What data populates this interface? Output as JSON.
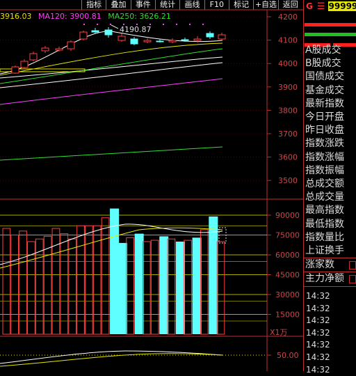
{
  "toolbar": [
    "指标",
    "叠加",
    "事件",
    "统计",
    "画线",
    "F10",
    "标记",
    "+自选",
    "返回"
  ],
  "ma_legend": {
    "ma_prev": "3916.03",
    "ma120": "MA120: 3900.81",
    "ma250": "MA250: 3626.21",
    "colors": {
      "ma_prev": "#e8e800",
      "ma120": "#ff40ff",
      "ma250": "#30e030"
    }
  },
  "price_annotation": "4190.87",
  "volume_unit": "X1万",
  "header": {
    "g": "G",
    "menu": "☰",
    "code": "99999"
  },
  "side_labels": [
    "A股成交",
    "B股成交",
    "国债成交",
    "基金成交",
    "最新指数",
    "今日开盘",
    "昨日收盘",
    "指数涨跌",
    "指数涨幅",
    "指数振幅",
    "总成交额",
    "总成交量",
    "最高指数",
    "最低指数",
    "指数量比",
    "上证换手"
  ],
  "section_labels": [
    "涨家数",
    "主力净额"
  ],
  "times": [
    "14:32",
    "14:32",
    "14:32",
    "14:32",
    "14:32",
    "14:32",
    "14:32"
  ],
  "chart_data": [
    {
      "type": "candlestick",
      "price_axis_ticks": [
        4200,
        4100,
        4000,
        3900,
        3800,
        3700,
        3600,
        3500
      ],
      "ylim": [
        3420,
        4230
      ],
      "annotation": "4190.87"
    },
    {
      "type": "bar",
      "unit": "X1万",
      "volume_axis_ticks": [
        90000,
        75000,
        60000,
        45000,
        30000,
        15000
      ],
      "ylim": [
        0,
        100000
      ],
      "values": [
        80000,
        75000,
        78000,
        70000,
        72000,
        74000,
        80000,
        76000,
        72000,
        82000,
        82000,
        82000,
        88000,
        95000,
        69000,
        73000,
        76000,
        70000,
        71000,
        74000,
        72000,
        70000,
        71000,
        73000,
        79000,
        89000,
        70000
      ]
    },
    {
      "type": "line",
      "axis_ticks": [
        50.0
      ]
    }
  ]
}
